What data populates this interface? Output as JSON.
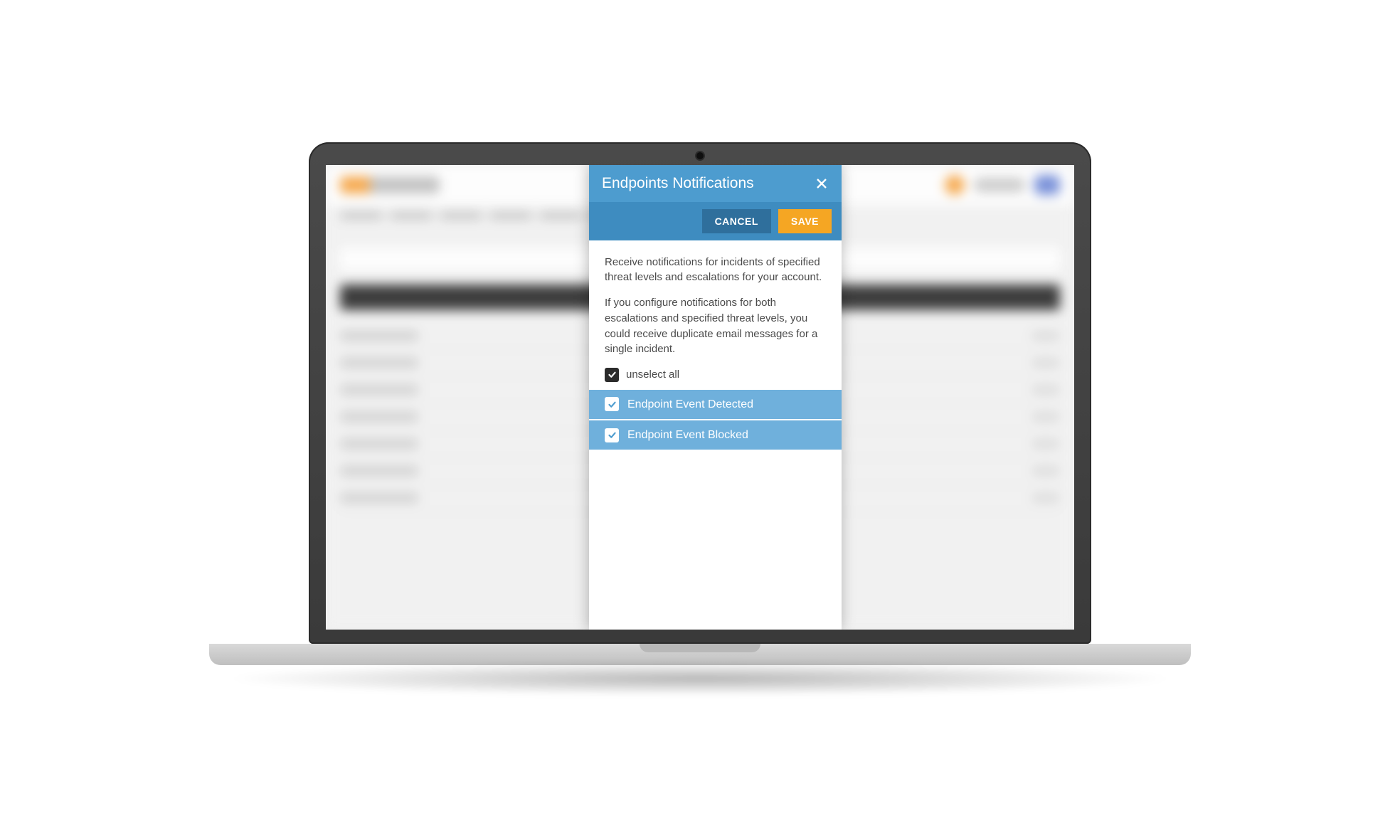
{
  "dialog": {
    "title": "Endpoints Notifications",
    "cancel_label": "CANCEL",
    "save_label": "SAVE",
    "description_1": "Receive notifications for incidents of specified threat levels and escalations for your account.",
    "description_2": "If you configure notifications for both escalations and specified threat levels, you could receive duplicate email messages for a single incident.",
    "select_all_label": "unselect all",
    "options": [
      {
        "label": "Endpoint Event Detected",
        "checked": true
      },
      {
        "label": "Endpoint Event Blocked",
        "checked": true
      }
    ]
  }
}
